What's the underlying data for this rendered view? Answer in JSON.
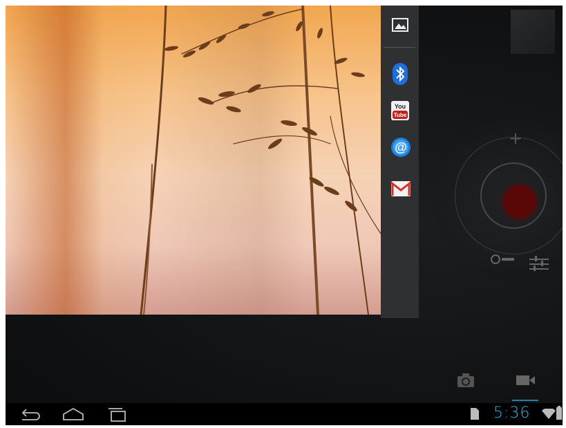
{
  "share_bar": {
    "items": [
      {
        "name": "Gallery",
        "icon": "gallery-icon"
      },
      {
        "name": "Bluetooth",
        "icon": "bluetooth-icon"
      },
      {
        "name": "YouTube",
        "icon": "youtube-icon",
        "line1": "You",
        "line2": "Tube"
      },
      {
        "name": "Email",
        "icon": "email-icon",
        "glyph": "@"
      },
      {
        "name": "Gmail",
        "icon": "gmail-icon",
        "glyph": "M"
      }
    ]
  },
  "camera": {
    "zoom_in_label": "+",
    "mode": "video",
    "shutter_color": "#5a0707"
  },
  "status_bar": {
    "time": "5:36",
    "time_color": "#33b5e5"
  },
  "navigation": {
    "buttons": [
      "back-icon",
      "home-icon",
      "recent-apps-icon"
    ]
  }
}
